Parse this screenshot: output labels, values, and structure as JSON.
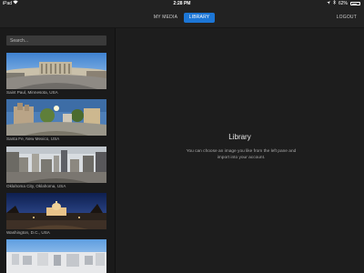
{
  "status": {
    "device": "iPad",
    "wifi_icon": "wifi-icon",
    "time": "2:28 PM",
    "battery": "62%",
    "battery_level": 0.62
  },
  "header": {
    "tabs": [
      {
        "label": "MY MEDIA",
        "active": false
      },
      {
        "label": "LIBRARY",
        "active": true
      }
    ],
    "logout": "LOGOUT",
    "accent": "#1c76d6"
  },
  "sidebar": {
    "search_placeholder": "Search...",
    "items": [
      {
        "caption": "Saint Paul, Minnesota, USA"
      },
      {
        "caption": "Santa Fe, New Mexico, USA"
      },
      {
        "caption": "Oklahoma City, Oklahoma, USA"
      },
      {
        "caption": "Washington, D.C., USA"
      },
      {
        "caption": ""
      }
    ]
  },
  "main": {
    "title": "Library",
    "description": "You can choose an image you like from the left pane and import into your account."
  }
}
